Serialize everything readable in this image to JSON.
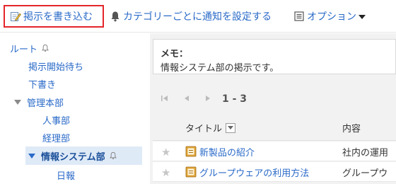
{
  "toolbar": {
    "post_label": "掲示を書き込む",
    "notify_label": "カテゴリーごとに通知を設定する",
    "options_label": "オプション"
  },
  "sidebar": {
    "items": [
      {
        "label": "ルート",
        "bell": true
      },
      {
        "label": "掲示開始待ち"
      },
      {
        "label": "下書き"
      },
      {
        "label": "管理本部",
        "expanded": true
      },
      {
        "label": "人事部"
      },
      {
        "label": "経理部"
      },
      {
        "label": "情報システム部",
        "expanded": true,
        "selected": true,
        "bell": true
      },
      {
        "label": "日報"
      }
    ]
  },
  "memo": {
    "label": "メモ：",
    "text": "情報システム部の掲示です。"
  },
  "pager": {
    "range": "1 - 3"
  },
  "table": {
    "columns": [
      "タイトル",
      "内容"
    ],
    "rows": [
      {
        "title": "新製品の紹介",
        "content": "社内の運用"
      },
      {
        "title": "グループウェアの利用方法",
        "content": "グループウ"
      }
    ]
  },
  "colors": {
    "link": "#2a6ac8",
    "highlight_border": "#e3262b",
    "selected_bg": "#dfeaf7"
  }
}
